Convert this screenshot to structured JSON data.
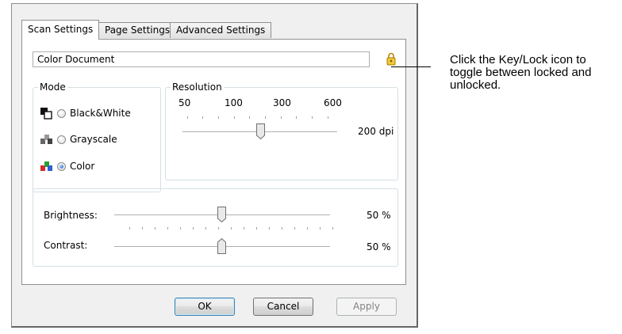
{
  "tabs": [
    {
      "label": "Scan Settings",
      "active": true
    },
    {
      "label": "Page Settings",
      "active": false
    },
    {
      "label": "Advanced Settings",
      "active": false
    }
  ],
  "preset": {
    "value": "Color Document"
  },
  "mode": {
    "title": "Mode",
    "options": [
      {
        "label": "Black&White",
        "icon": "black-white-icon",
        "selected": false
      },
      {
        "label": "Grayscale",
        "icon": "grayscale-icon",
        "selected": false
      },
      {
        "label": "Color",
        "icon": "color-icon",
        "selected": true
      }
    ]
  },
  "resolution": {
    "title": "Resolution",
    "ticks": [
      "50",
      "100",
      "300",
      "600"
    ],
    "value": "200 dpi"
  },
  "brightness": {
    "label": "Brightness:",
    "value": "50 %"
  },
  "contrast": {
    "label": "Contrast:",
    "value": "50 %"
  },
  "buttons": {
    "ok": "OK",
    "cancel": "Cancel",
    "apply": "Apply"
  },
  "callout": {
    "text": "Click the Key/Lock icon to toggle between locked and unlocked."
  },
  "colors": {
    "accent": "#3c7fb1",
    "lock": "#e5b92c"
  }
}
